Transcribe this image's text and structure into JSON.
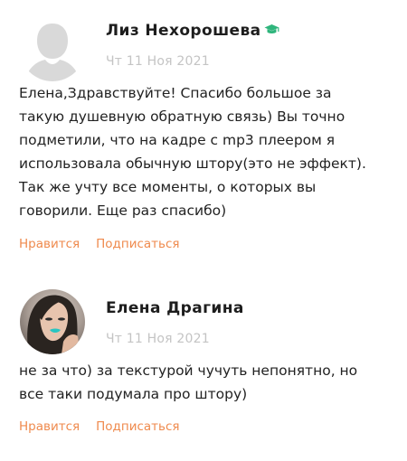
{
  "comments": [
    {
      "author": "Лиз Нехорошева",
      "date": "Чт 11 Ноя 2021",
      "avatar_icon": "default-user-avatar",
      "badge_icon": "graduation-cap-icon",
      "badge_color": "#2fb57c",
      "lines": [
        "Елена,Здравствуйте! Спасибо большое за",
        "такую душевную обратную связь) Вы точно",
        "подметили, что на кадре с mp3 плеером я",
        "использовала обычную штору(это не эффект).",
        "Так же учту все моменты, о которых вы",
        "говорили. Еще раз спасибо)"
      ],
      "like_label": "Нравится",
      "subscribe_label": "Подписаться"
    },
    {
      "author": "Елена Драгина",
      "date": "Чт 11 Ноя 2021",
      "avatar_icon": "user-photo-avatar",
      "lines": [
        "не за что) за текстурой чучуть непонятно, но",
        "все таки подумала про штору)"
      ],
      "like_label": "Нравится",
      "subscribe_label": "Подписаться"
    }
  ],
  "colors": {
    "action": "#ef8a4d",
    "date": "#c4c4c4",
    "text": "#222222",
    "placeholder_avatar": "#d9d9d9"
  }
}
